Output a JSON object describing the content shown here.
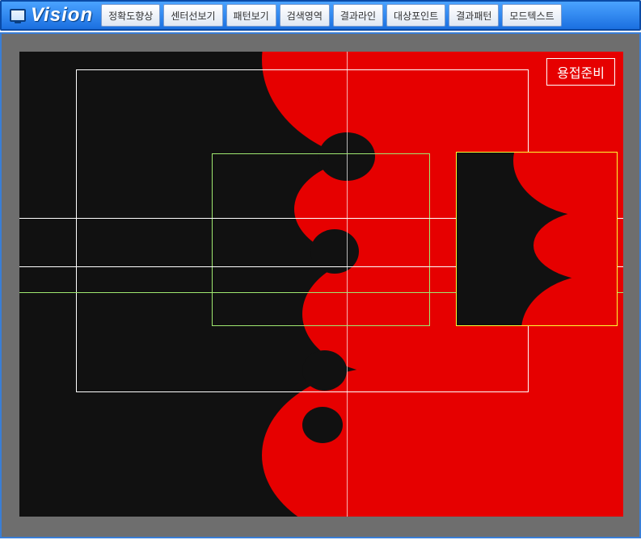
{
  "toolbar": {
    "title": "Vision",
    "buttons": [
      {
        "label": "정확도향상"
      },
      {
        "label": "센터선보기"
      },
      {
        "label": "패턴보기"
      },
      {
        "label": "검색영역"
      },
      {
        "label": "결과라인"
      },
      {
        "label": "대상포인트"
      },
      {
        "label": "결과패턴"
      },
      {
        "label": "모드텍스트"
      }
    ]
  },
  "status_label": "용접준비",
  "colors": {
    "accent_blue": "#1b6fe0",
    "frame_gray": "#6e6e6e",
    "image_red": "#e60000",
    "silhouette_black": "#111111",
    "guide_white": "#ffffff",
    "guide_green": "#9fe870",
    "result_yellow": "#ffff33"
  }
}
